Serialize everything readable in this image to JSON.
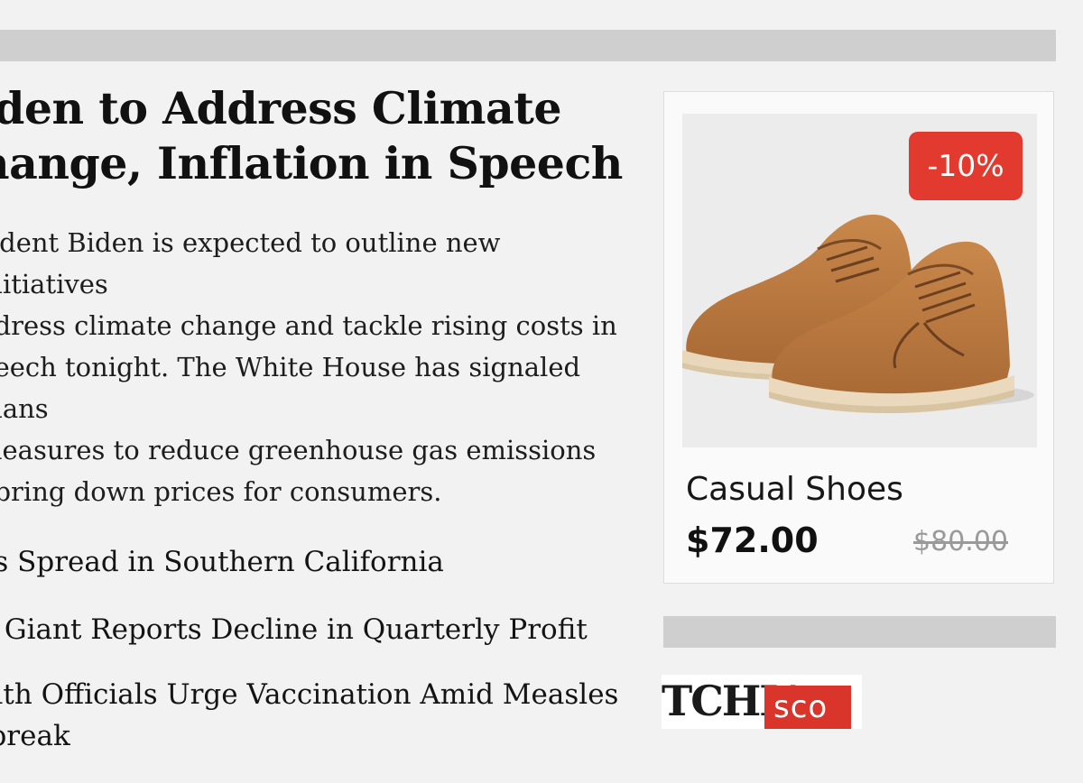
{
  "article": {
    "headline": "iden to Address Climate hange, Inflation in Speech",
    "headline_lines": [
      "iden to Address Climate",
      "hange, Inflation in Speech"
    ],
    "summary_lines": [
      "sident Biden is expected to outline new initiatives",
      "ddress climate change and tackle rising costs in",
      "peech tonight. The White House has signaled plans",
      "measures to reduce greenhouse gas emissions",
      "l bring down prices for consumers."
    ],
    "related": [
      {
        "title": "es Spread in Southern California"
      },
      {
        "title": "h Giant Reports Decline in Quarterly Profit"
      },
      {
        "title_lines": [
          "alth Officials Urge Vaccination Amid Measles",
          "tbreak"
        ]
      }
    ]
  },
  "product": {
    "discount": "-10%",
    "name": "Casual Shoes",
    "price": "$72.00",
    "original_price": "$80.00",
    "image_icon": "suede-shoes-image"
  },
  "logo": {
    "text": "TCHIA",
    "tag": "sco"
  },
  "colors": {
    "background": "#f2f2f2",
    "placeholder_bar": "#cfcfcf",
    "badge": "#e23a2f",
    "shoe": "#b9763d"
  }
}
